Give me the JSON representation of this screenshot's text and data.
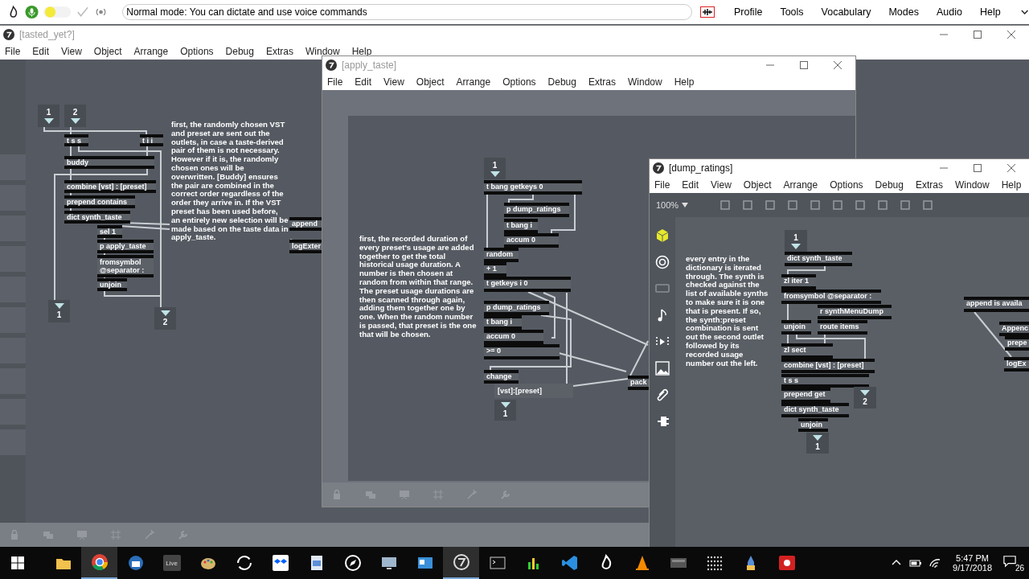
{
  "dictation_bar": {
    "status": "Normal mode: You can dictate and use voice commands",
    "menu": [
      "Profile",
      "Tools",
      "Vocabulary",
      "Modes",
      "Audio",
      "Help"
    ]
  },
  "windows": [
    {
      "title": "[tasted_yet?]",
      "active": false,
      "menu": [
        "File",
        "Edit",
        "View",
        "Object",
        "Arrange",
        "Options",
        "Debug",
        "Extras",
        "Window",
        "Help"
      ],
      "objects": [
        {
          "kind": "inlet",
          "text": "1"
        },
        {
          "kind": "inlet",
          "text": "2"
        },
        {
          "kind": "object",
          "text": "t s s"
        },
        {
          "kind": "object",
          "text": "t i i"
        },
        {
          "kind": "object",
          "text": "buddy"
        },
        {
          "kind": "object",
          "text": "combine [vst] : [preset]"
        },
        {
          "kind": "object",
          "text": "prepend contains"
        },
        {
          "kind": "object",
          "text": "dict synth_taste"
        },
        {
          "kind": "object",
          "text": "sel 1"
        },
        {
          "kind": "object",
          "text": "p apply_taste"
        },
        {
          "kind": "object",
          "text": "fromsymbol @separator :"
        },
        {
          "kind": "object",
          "text": "unjoin"
        },
        {
          "kind": "outlet",
          "text": "1"
        },
        {
          "kind": "outlet",
          "text": "2"
        },
        {
          "kind": "comment",
          "text": "first, the randomly chosen VST and preset are sent out the outlets, in case a taste-derived pair of them is not necessary. However if it is, the randomly chosen ones will be overwritten. [Buddy]  ensures the pair are combined in the correct order regardless of the order they arrive in. If the VST preset has been used before, an entirely new selection will be made based on the taste data in apply_taste."
        },
        {
          "kind": "object",
          "text": "append"
        },
        {
          "kind": "object",
          "text": "logExter"
        }
      ]
    },
    {
      "title": "[apply_taste]",
      "active": false,
      "menu": [
        "File",
        "Edit",
        "View",
        "Object",
        "Arrange",
        "Options",
        "Debug",
        "Extras",
        "Window",
        "Help"
      ],
      "objects": [
        {
          "kind": "inlet",
          "text": "1"
        },
        {
          "kind": "object",
          "text": "t bang getkeys 0"
        },
        {
          "kind": "object",
          "text": "p dump_ratings"
        },
        {
          "kind": "object",
          "text": "t bang i"
        },
        {
          "kind": "object",
          "text": "accum 0"
        },
        {
          "kind": "object",
          "text": "random"
        },
        {
          "kind": "object",
          "text": "+ 1"
        },
        {
          "kind": "object",
          "text": "t getkeys i 0"
        },
        {
          "kind": "object",
          "text": "p dump_ratings"
        },
        {
          "kind": "object",
          "text": "t bang i"
        },
        {
          "kind": "object",
          "text": "accum 0"
        },
        {
          "kind": "object",
          "text": ">= 0"
        },
        {
          "kind": "object",
          "text": "change"
        },
        {
          "kind": "message",
          "text": "[vst]:[preset]"
        },
        {
          "kind": "outlet",
          "text": "1"
        },
        {
          "kind": "object",
          "text": "pack"
        },
        {
          "kind": "comment",
          "text": " first, the recorded duration of every preset's usage are added together to get the total historical usage duration. A number is then chosen at random from within that range. The preset usage durations are then scanned through again, adding them together one by one. When the random number is passed, that preset is the one that will be chosen."
        }
      ]
    },
    {
      "title": "[dump_ratings]",
      "active": true,
      "zoom": "100%",
      "menu": [
        "File",
        "Edit",
        "View",
        "Object",
        "Arrange",
        "Options",
        "Debug",
        "Extras",
        "Window",
        "Help"
      ],
      "objects": [
        {
          "kind": "inlet",
          "text": "1"
        },
        {
          "kind": "object",
          "text": "dict synth_taste"
        },
        {
          "kind": "object",
          "text": "zl iter 1"
        },
        {
          "kind": "object",
          "text": "fromsymbol @separator :"
        },
        {
          "kind": "object",
          "text": "r synthMenuDump"
        },
        {
          "kind": "object",
          "text": "unjoin"
        },
        {
          "kind": "object",
          "text": "route items"
        },
        {
          "kind": "object",
          "text": "zl sect"
        },
        {
          "kind": "object",
          "text": "combine [vst] : [preset]"
        },
        {
          "kind": "object",
          "text": "t s s"
        },
        {
          "kind": "object",
          "text": "prepend get"
        },
        {
          "kind": "object",
          "text": "dict synth_taste"
        },
        {
          "kind": "object",
          "text": "unjoin"
        },
        {
          "kind": "outlet",
          "text": "2"
        },
        {
          "kind": "outlet",
          "text": "1"
        },
        {
          "kind": "comment",
          "text": " every entry in the dictionary is iterated through. The synth  is checked against the list of available synths to make sure it is one that is present.  If so, the synth:preset combination is sent out the second outlet followed by its recorded usage number out the left."
        },
        {
          "kind": "object",
          "text": "append is availa"
        },
        {
          "kind": "object",
          "text": "Appenc"
        },
        {
          "kind": "object",
          "text": "prepe"
        },
        {
          "kind": "object",
          "text": "logEx"
        }
      ]
    }
  ],
  "taskbar": {
    "apps": [
      {
        "kind": "folder",
        "active": false
      },
      {
        "kind": "chrome",
        "active": true
      },
      {
        "kind": "mail",
        "active": false
      },
      {
        "kind": "live",
        "label": "Live",
        "active": false
      },
      {
        "kind": "paint",
        "active": false
      },
      {
        "kind": "sync",
        "active": false
      },
      {
        "kind": "dropbox",
        "active": false
      },
      {
        "kind": "document",
        "active": false
      },
      {
        "kind": "compass",
        "active": false
      },
      {
        "kind": "monitor",
        "active": false
      },
      {
        "kind": "card",
        "active": false
      },
      {
        "kind": "max",
        "active": true
      },
      {
        "kind": "terminal",
        "active": false
      },
      {
        "kind": "chart",
        "active": false
      },
      {
        "kind": "vscode",
        "active": false
      },
      {
        "kind": "flame",
        "active": false
      },
      {
        "kind": "cone",
        "active": false
      },
      {
        "kind": "midi",
        "active": false
      },
      {
        "kind": "dots",
        "active": false
      },
      {
        "kind": "python",
        "active": false
      },
      {
        "kind": "record",
        "active": false
      }
    ],
    "time": "5:47 PM",
    "date": "9/17/2018",
    "notifications": "26"
  }
}
